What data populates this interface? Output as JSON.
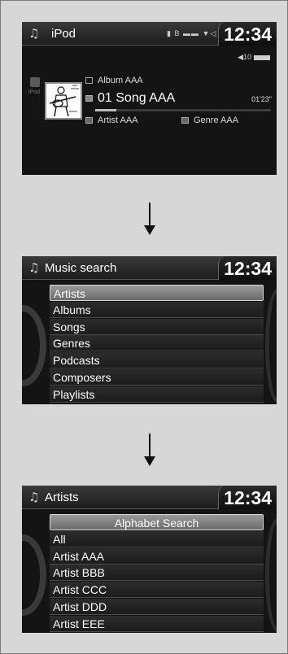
{
  "screen1": {
    "title": "iPod",
    "clock": "12:34",
    "status": "▮ B ▬▬ ▼◁",
    "volume": "◀10",
    "side_label": "iPod",
    "album": "Album AAA",
    "song": "01 Song AAA",
    "elapsed": "01'23\"",
    "artist": "Artist AAA",
    "genre": "Genre AAA",
    "progress": 0.12
  },
  "screen2": {
    "title": "Music search",
    "clock": "12:34",
    "items": [
      {
        "label": "Artists"
      },
      {
        "label": "Albums"
      },
      {
        "label": "Songs"
      },
      {
        "label": "Genres"
      },
      {
        "label": "Podcasts"
      },
      {
        "label": "Composers"
      },
      {
        "label": "Playlists"
      }
    ]
  },
  "screen3": {
    "title": "Artists",
    "clock": "12:34",
    "items": [
      {
        "label": "Alphabet Search"
      },
      {
        "label": "All"
      },
      {
        "label": "Artist AAA"
      },
      {
        "label": "Artist BBB"
      },
      {
        "label": "Artist CCC"
      },
      {
        "label": "Artist DDD"
      },
      {
        "label": "Artist EEE"
      }
    ]
  },
  "icons": {
    "music_note": "music-note-icon",
    "arrow": "arrow-down-icon"
  }
}
